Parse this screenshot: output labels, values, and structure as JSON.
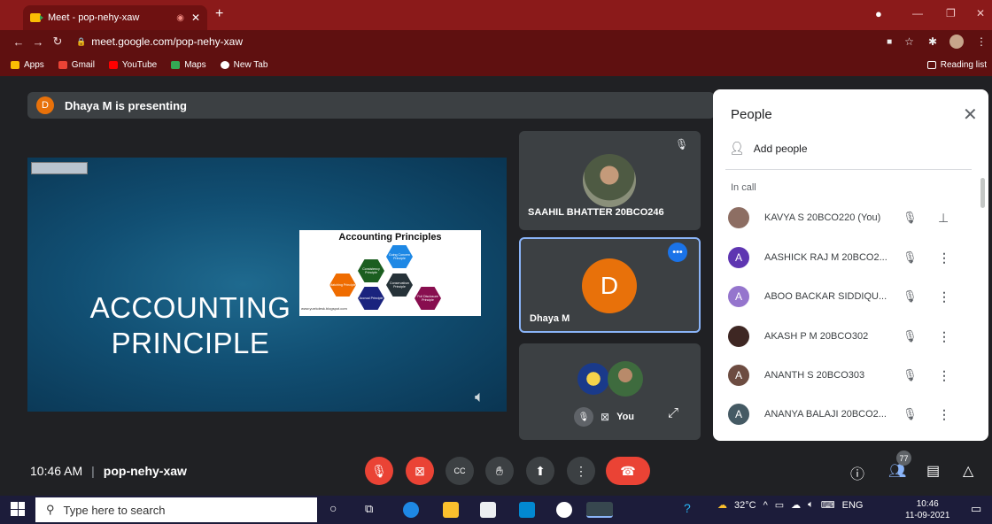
{
  "browser": {
    "tab_title": "Meet - pop-nehy-xaw",
    "new_tab_symbol": "+",
    "url": "meet.google.com/pop-nehy-xaw",
    "bookmarks": [
      "Apps",
      "Gmail",
      "YouTube",
      "Maps",
      "New Tab"
    ],
    "reading_list": "Reading list"
  },
  "meet": {
    "presenter_initial": "D",
    "presenting_text": "Dhaya M is presenting",
    "slide": {
      "title_line1": "ACCOUNTING",
      "title_line2": "PRINCIPLE",
      "image_title": "Accounting Principles",
      "hexagons": [
        "Going Concern Principle",
        "Consistency Principle",
        "Conservatism Principle",
        "Matching Principle",
        "Accrual Principle",
        "Full Disclosure Principle"
      ],
      "image_url": "www.yurrkdesk.blogspot.com"
    },
    "tiles": [
      {
        "name": "SAAHIL BHATTER 20BCO246"
      },
      {
        "name": "Dhaya M",
        "initial": "D"
      },
      {
        "name": "You"
      }
    ],
    "meeting_time": "10:46 AM",
    "meeting_code": "pop-nehy-xaw",
    "participants_count": "77"
  },
  "people_panel": {
    "title": "People",
    "add_people": "Add people",
    "section": "In call",
    "participants": [
      {
        "name": "KAVYA S 20BCO220 (You)",
        "initial": "",
        "color": "#8d6e63"
      },
      {
        "name": "AASHICK RAJ M 20BCO2...",
        "initial": "A",
        "color": "#5e35b1"
      },
      {
        "name": "ABOO BACKAR SIDDIQU...",
        "initial": "A",
        "color": "#9575cd"
      },
      {
        "name": "AKASH P M 20BCO302",
        "initial": "",
        "color": "#3e2723"
      },
      {
        "name": "ANANTH S 20BCO303",
        "initial": "A",
        "color": "#6d4c41"
      },
      {
        "name": "ANANYA BALAJI 20BCO2...",
        "initial": "A",
        "color": "#455a64"
      }
    ]
  },
  "taskbar": {
    "search_placeholder": "Type here to search",
    "weather": "32°C",
    "lang": "ENG",
    "time": "10:46",
    "date": "11-09-2021"
  }
}
